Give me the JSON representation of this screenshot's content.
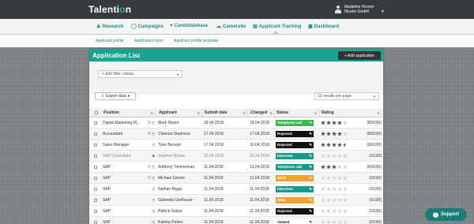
{
  "app": {
    "logo_pre": "Talenti",
    "logo_dot": "o",
    "logo_post": "n"
  },
  "user": {
    "name": "Madeline Hoover",
    "company": "Muster GmbH"
  },
  "nav": {
    "items": [
      {
        "label": "Research",
        "icon": "person-search-icon"
      },
      {
        "label": "Campaigns",
        "icon": "lightbulb-icon"
      },
      {
        "label": "Candidatebase",
        "icon": "heart-icon"
      },
      {
        "label": "Careersite",
        "icon": "cloud-icon"
      },
      {
        "label": "Applicant Tracking",
        "icon": "document-icon"
      },
      {
        "label": "Dashboard",
        "icon": "bar-chart-icon"
      }
    ],
    "active": "Applicant Tracking"
  },
  "subnav": {
    "items": [
      "Applicant profile",
      "Application form",
      "Applicant profile template"
    ]
  },
  "panel": {
    "title": "Application List",
    "add_button": "Add application",
    "filter_placeholder": "+ Add filter criteria",
    "export_button": "Export data",
    "results_per_page": "15 results per page"
  },
  "table": {
    "headers": [
      "Position",
      "Applicant",
      "Submit date",
      "Changed",
      "Status",
      "Rating"
    ],
    "rows": [
      {
        "position": "Digital Marketing M...",
        "applicant": "Mark Moore",
        "submit": "18.04.2018",
        "changed": "18.04.2018",
        "status": "Telephone call",
        "status_color": "#3fb94c",
        "stars": 4,
        "half": false,
        "score": "(80/100)",
        "icons": "double",
        "muted": false
      },
      {
        "position": "Accountant",
        "applicant": "Chelsea Stephens",
        "submit": "17.04.2018",
        "changed": "17.04.2018",
        "status": "Rejected",
        "status_color": "#111111",
        "stars": 4,
        "half": false,
        "score": "(80/100)",
        "icons": "double",
        "muted": false
      },
      {
        "position": "Sales Manager",
        "applicant": "Tyler Benson",
        "submit": "17.04.2018",
        "changed": "16.04.2018",
        "status": "Rejected",
        "status_color": "#111111",
        "stars": 4,
        "half": true,
        "score": "(90/100)",
        "icons": "single",
        "muted": false
      },
      {
        "position": "SAP Consultant",
        "applicant": "Stephen Brown",
        "submit": "12.04.2018",
        "changed": "16.04.2018",
        "status": "Interview",
        "status_color": "#1a9a8a",
        "stars": 0,
        "half": false,
        "score": "(0/100)",
        "icons": "person",
        "muted": true
      },
      {
        "position": "SAP",
        "applicant": "Anthony Timmerman",
        "submit": "11.04.2018",
        "changed": "13.04.2018",
        "status": "Telephone call",
        "status_color": "#1a9a8a",
        "stars": 3,
        "half": false,
        "score": "(60/100)",
        "icons": "double",
        "muted": false
      },
      {
        "position": "SAP",
        "applicant": "Michael Gerber",
        "submit": "11.04.2018",
        "changed": "12.04.2018",
        "status": "NEW",
        "status_color": "#f2a22c",
        "stars": 0,
        "half": false,
        "score": "(0/100)",
        "icons": "double",
        "muted": false
      },
      {
        "position": "SAP",
        "applicant": "Nathan Riggs",
        "submit": "11.04.2018",
        "changed": "11.04.2018",
        "status": "Interview",
        "status_color": "#1a9a8a",
        "stars": 0,
        "half": false,
        "score": "(0/100)",
        "icons": "single",
        "muted": false
      },
      {
        "position": "SAP",
        "applicant": "Gabriella Gerthauer",
        "submit": "11.04.2018",
        "changed": "11.04.2018",
        "status": "NEW",
        "status_color": "#f2a22c",
        "stars": 0,
        "half": false,
        "score": "(0/100)",
        "icons": "single",
        "muted": false
      },
      {
        "position": "SAP",
        "applicant": "Patrick Salzer",
        "submit": "11.04.2018",
        "changed": "11.04.2018",
        "status": "Rejected",
        "status_color": "#111111",
        "stars": 0,
        "half": false,
        "score": "(0/100)",
        "icons": "single",
        "muted": false
      },
      {
        "position": "SAP",
        "applicant": "Katrina Peters",
        "submit": "11.04.2018",
        "changed": "11.04.2018",
        "status": "Viewed",
        "status_color": "#ffffff",
        "stars": 0,
        "half": false,
        "score": "(0/100)",
        "icons": "single",
        "muted": false
      }
    ]
  },
  "support": {
    "label": "Support"
  }
}
